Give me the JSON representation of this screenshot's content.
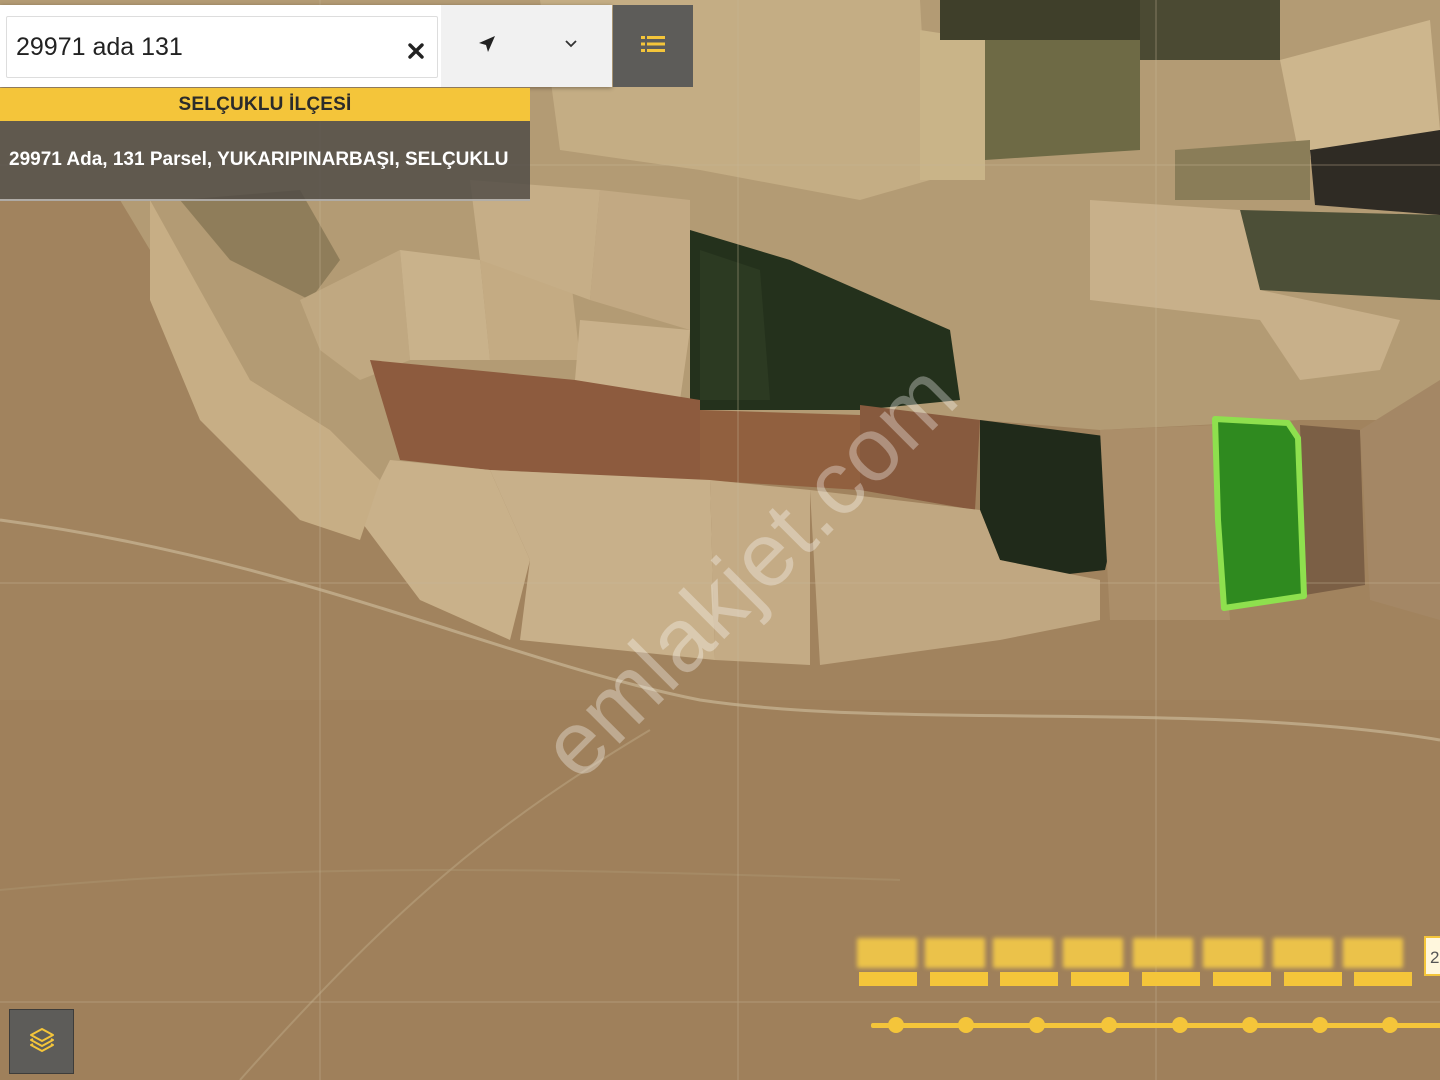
{
  "search": {
    "value": "29971 ada 131",
    "placeholder": ""
  },
  "icons": {
    "clear": "close-icon",
    "locate": "location-arrow-icon",
    "dropdown": "chevron-down-icon",
    "menu": "list-icon",
    "layers": "layers-icon"
  },
  "result": {
    "district": "SELÇUKLU İLÇESİ",
    "parcel": "29971 Ada, 131 Parsel, YUKARIPINARBAŞI, SELÇUKLU"
  },
  "watermark": "emlakjet.com",
  "timeline": {
    "visible_fragment": "2"
  },
  "colors": {
    "accent": "#f4c53a",
    "dark_button": "#5d5c59",
    "parcel_fill": "#2f8a1f",
    "parcel_outline": "#8ee04e"
  }
}
